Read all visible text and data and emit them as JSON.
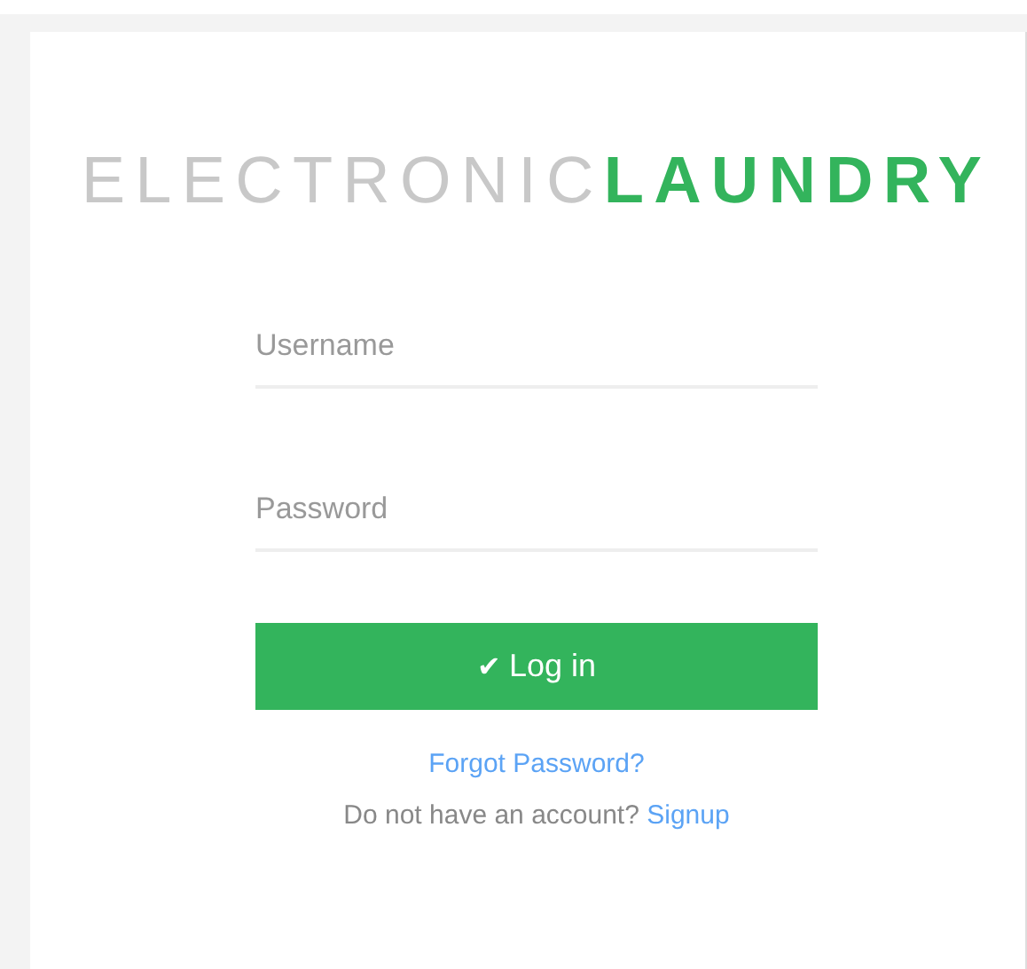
{
  "logo": "ELECTRONIC**LAUNDRY**",
  "fields": [
    {
      "placeholder": "Username"
    },
    {
      "placeholder": "Password"
    }
  ],
  "login_button": {
    "icon": "✔",
    "label": "Log in"
  },
  "forgot_link": "Forgot Password?",
  "signup": {
    "text": "Do not have an account?",
    "link": "Signup"
  }
}
